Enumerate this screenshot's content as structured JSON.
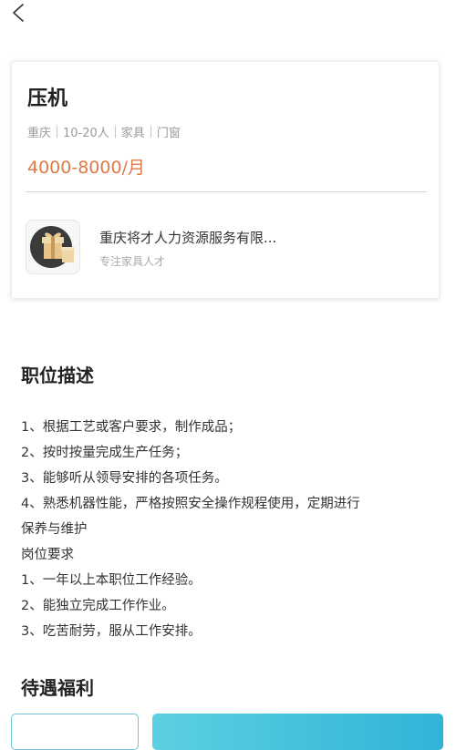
{
  "nav": {
    "back_icon": "chevron-left-icon"
  },
  "job": {
    "title": "压机",
    "tags": [
      "重庆",
      "10-20人",
      "家具",
      "门窗"
    ],
    "salary": "4000-8000/月",
    "salary_color": "#e07a45"
  },
  "company": {
    "logo_icon": "gift-box-icon",
    "name": "重庆将才人力资源服务有限...",
    "subtitle": "专注家具人才"
  },
  "description": {
    "title": "职位描述",
    "lines": [
      "1、根据工艺或客户要求，制作成品；",
      "2、按时按量完成生产任务；",
      "3、能够听从领导安排的各项任务。",
      "4、熟悉机器性能，严格按照安全操作规程使用，定期进行",
      "保养与维护",
      "岗位要求",
      "1、一年以上本职位工作经验。",
      "2、能独立完成工作作业。",
      "3、吃苦耐劳，服从工作安排。"
    ]
  },
  "welfare": {
    "title": "待遇福利",
    "accent_color": "#31b3d9"
  }
}
